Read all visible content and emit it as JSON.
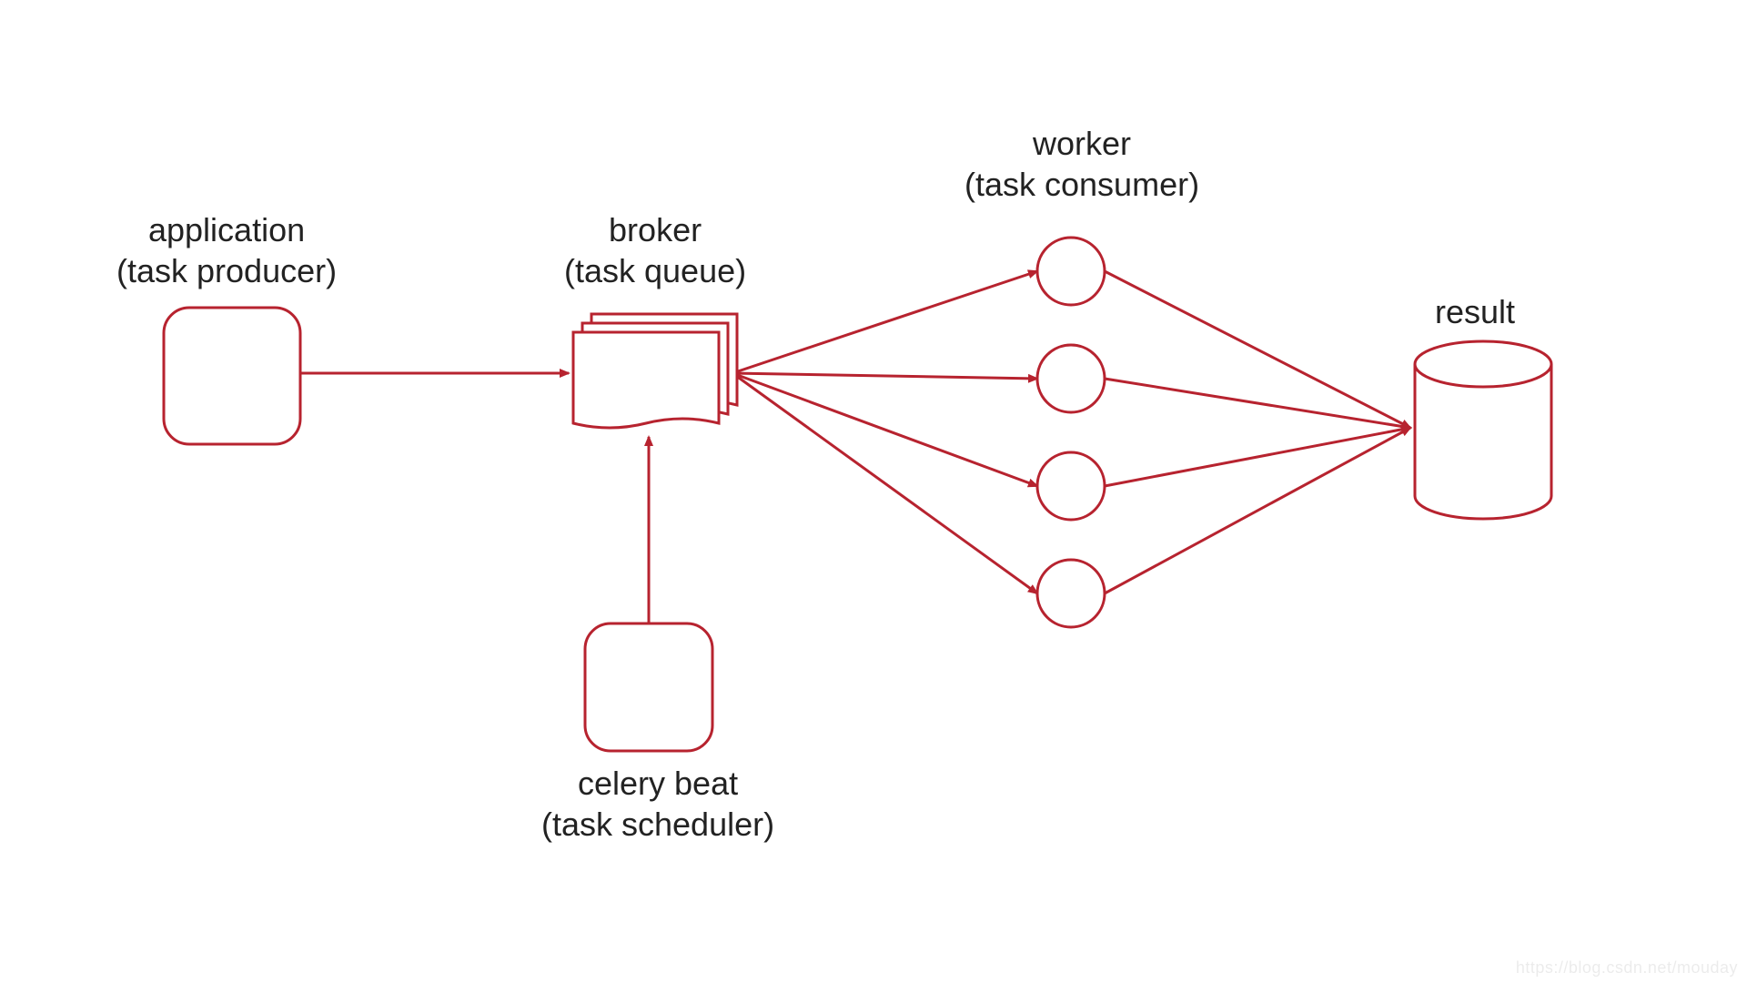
{
  "labels": {
    "application": {
      "line1": "application",
      "line2": "(task producer)"
    },
    "broker": {
      "line1": "broker",
      "line2": "(task queue)"
    },
    "worker": {
      "line1": "worker",
      "line2": "(task consumer)"
    },
    "celerybeat": {
      "line1": "celery beat",
      "line2": "(task scheduler)"
    },
    "result": {
      "line1": "result"
    }
  },
  "watermark": "https://blog.csdn.net/mouday",
  "colors": {
    "stroke": "#B7232F",
    "text": "#222222",
    "bg": "#ffffff"
  },
  "diagram": {
    "nodes": [
      {
        "id": "application",
        "type": "rounded-rect"
      },
      {
        "id": "broker",
        "type": "stacked-docs"
      },
      {
        "id": "celerybeat",
        "type": "rounded-rect"
      },
      {
        "id": "worker-1",
        "type": "circle"
      },
      {
        "id": "worker-2",
        "type": "circle"
      },
      {
        "id": "worker-3",
        "type": "circle"
      },
      {
        "id": "worker-4",
        "type": "circle"
      },
      {
        "id": "result",
        "type": "cylinder"
      }
    ],
    "edges": [
      {
        "from": "application",
        "to": "broker"
      },
      {
        "from": "celerybeat",
        "to": "broker"
      },
      {
        "from": "broker",
        "to": "worker-1"
      },
      {
        "from": "broker",
        "to": "worker-2"
      },
      {
        "from": "broker",
        "to": "worker-3"
      },
      {
        "from": "broker",
        "to": "worker-4"
      },
      {
        "from": "worker-1",
        "to": "result"
      },
      {
        "from": "worker-2",
        "to": "result"
      },
      {
        "from": "worker-3",
        "to": "result"
      },
      {
        "from": "worker-4",
        "to": "result"
      }
    ]
  }
}
